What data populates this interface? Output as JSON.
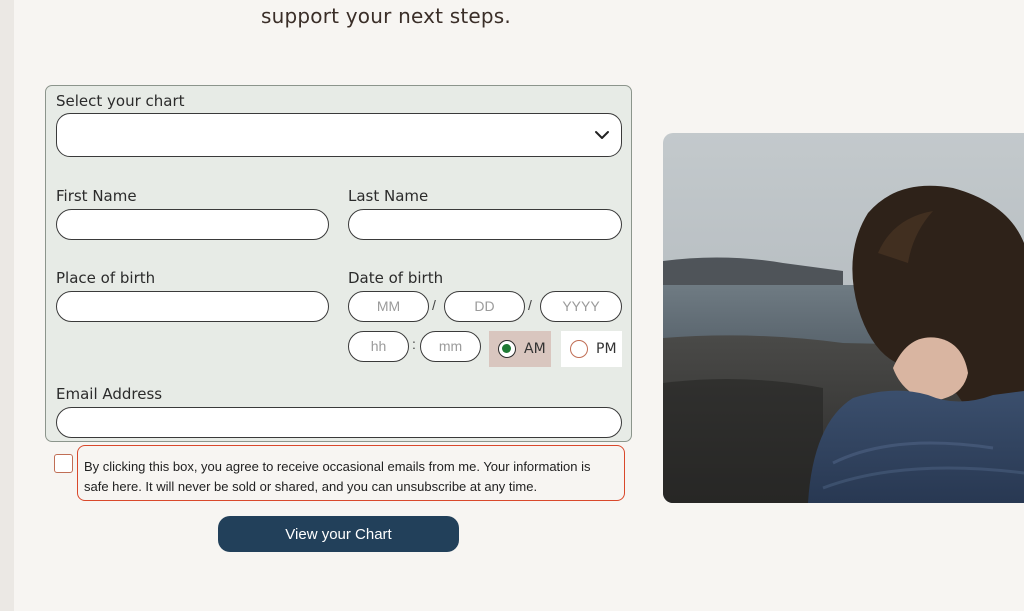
{
  "intro": {
    "text": "support your next steps."
  },
  "form": {
    "chart_select": {
      "label": "Select your chart",
      "value": ""
    },
    "first_name": {
      "label": "First Name",
      "value": ""
    },
    "last_name": {
      "label": "Last Name",
      "value": ""
    },
    "place_of_birth": {
      "label": "Place of birth",
      "value": ""
    },
    "date_of_birth": {
      "label": "Date of birth",
      "month_placeholder": "MM",
      "day_placeholder": "DD",
      "year_placeholder": "YYYY",
      "separator": "/"
    },
    "time_of_birth": {
      "hour_placeholder": "hh",
      "minute_placeholder": "mm",
      "separator": ":",
      "am_label": "AM",
      "pm_label": "PM",
      "selected": "AM"
    },
    "email": {
      "label": "Email Address",
      "value": ""
    }
  },
  "consent": {
    "checked": false,
    "text": "By clicking this box, you agree to receive occasional emails from me. Your information is safe here. It will never be sold or shared, and you can unsubscribe at any time."
  },
  "submit": {
    "label": "View your Chart"
  },
  "colors": {
    "submit_bg": "#22405a",
    "form_bg": "#e7ebe6",
    "am_highlight": "#d9c6bf",
    "consent_border": "#d9482b",
    "radio_selected": "#1f7a34"
  },
  "photo": {
    "icon": "photo-woman-by-sea"
  }
}
